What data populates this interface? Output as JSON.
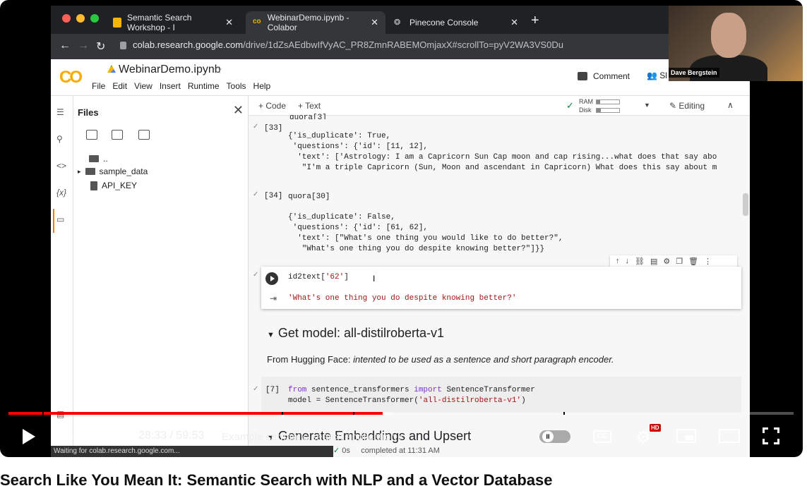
{
  "browser": {
    "tabs": [
      {
        "label": "Semantic Search Workshop - I"
      },
      {
        "label": "WebinarDemo.ipynb - Colabor"
      },
      {
        "label": "Pinecone Console"
      }
    ],
    "url_host": "colab.research.google.com",
    "url_path": "/drive/1dZsAEdbwIfVyAC_PR8ZmnRABEMOmjaxX#scrollTo=pyV2WA3VS0Du"
  },
  "colab": {
    "logo": "CO",
    "notebook_name": "WebinarDemo.ipynb",
    "menus": [
      "File",
      "Edit",
      "View",
      "Insert",
      "Runtime",
      "Tools",
      "Help"
    ],
    "comment_label": "Comment",
    "share_label": "Sl",
    "add_code": "+ Code",
    "add_text": "+ Text",
    "ram_label": "RAM",
    "disk_label": "Disk",
    "editing_label": "Editing"
  },
  "files_panel": {
    "title": "Files",
    "items": [
      {
        "label": ".."
      },
      {
        "label": "sample_data"
      },
      {
        "label": "API_KEY"
      }
    ]
  },
  "cells": {
    "partial_top": "quora[3]",
    "cell33_no": "[33]",
    "cell33_output": "{'is_duplicate': True,\n 'questions': {'id': [11, 12],\n  'text': ['Astrology: I am a Capricorn Sun Cap moon and cap rising...what does that say abo\n   \"I'm a triple Capricorn (Sun, Moon and ascendant in Capricorn) What does this say about m",
    "cell34_no": "[34]",
    "cell34_code": "quora[30]",
    "cell34_output": "{'is_duplicate': False,\n 'questions': {'id': [61, 62],\n  'text': [\"What's one thing you would like to do better?\",\n   \"What's one thing you do despite knowing better?\"]}}",
    "active_code_fn": "id2text[",
    "active_code_arg": "'62'",
    "active_code_end": "]",
    "active_output": "'What's one thing you do despite knowing better?'",
    "section_title": "Get model: all-distilroberta-v1",
    "hf_prefix": "From Hugging Face: ",
    "hf_desc": "intented to be used as a sentence and short paragraph encoder.",
    "cell7_no": "[7]",
    "cell7_kw1": "from",
    "cell7_mod": " sentence_transformers ",
    "cell7_kw2": "import",
    "cell7_cls": " SentenceTransformer",
    "cell7_line2a": "model = SentenceTransformer(",
    "cell7_line2s": "'all-distilroberta-v1'",
    "cell7_line2b": ")",
    "exec_time": "0s",
    "completed": "completed at 11:31 AM",
    "next_section": "Generate Embeddings and Upsert",
    "status": "Waiting for colab.research.google.com..."
  },
  "webcam": {
    "name": "Dave Bergstein"
  },
  "player": {
    "time": "28:33 / 59:53",
    "chapter": "Example semantic search application",
    "progress_fraction": 0.477,
    "buffered_fraction": 0.49,
    "hd_badge": "HD",
    "cc_label": "CC"
  },
  "video_title": "Search Like You Mean It: Semantic Search with NLP and a Vector Database"
}
